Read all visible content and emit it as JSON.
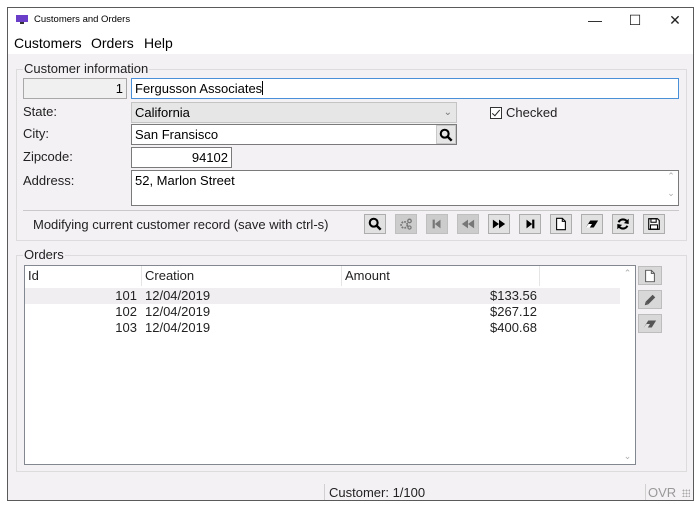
{
  "window": {
    "title": "Customers and Orders",
    "controls": {
      "minimize": "—",
      "maximize": "☐",
      "close": "✕"
    }
  },
  "menu": [
    "Customers",
    "Orders",
    "Help"
  ],
  "customer_info": {
    "group_label": "Customer information",
    "id_value": "1",
    "name_value": "Fergusson Associates",
    "state_label": "State:",
    "state_value": "California",
    "checkbox_label": "Checked",
    "checkbox_checked": true,
    "city_label": "City:",
    "city_value": "San Fransisco",
    "zip_label": "Zipcode:",
    "zip_value": "94102",
    "address_label": "Address:",
    "address_value": "52, Marlon Street"
  },
  "toolbar": {
    "status_message": "Modifying current customer record (save with ctrl-s)",
    "buttons": [
      {
        "name": "search",
        "icon": "search-icon",
        "enabled": true
      },
      {
        "name": "settings",
        "icon": "gears-icon",
        "enabled": false
      },
      {
        "name": "first",
        "icon": "first-record-icon",
        "enabled": false
      },
      {
        "name": "previous",
        "icon": "previous-record-icon",
        "enabled": false
      },
      {
        "name": "next",
        "icon": "next-record-icon",
        "enabled": true
      },
      {
        "name": "last",
        "icon": "last-record-icon",
        "enabled": true
      },
      {
        "name": "new",
        "icon": "new-document-icon",
        "enabled": true
      },
      {
        "name": "delete",
        "icon": "eraser-icon",
        "enabled": true
      },
      {
        "name": "refresh",
        "icon": "refresh-icon",
        "enabled": true
      },
      {
        "name": "save",
        "icon": "save-icon",
        "enabled": true
      }
    ]
  },
  "orders": {
    "group_label": "Orders",
    "columns": [
      "Id",
      "Creation",
      "Amount"
    ],
    "rows": [
      {
        "id": "101",
        "creation": "12/04/2019",
        "amount": "$133.56"
      },
      {
        "id": "102",
        "creation": "12/04/2019",
        "amount": "$267.12"
      },
      {
        "id": "103",
        "creation": "12/04/2019",
        "amount": "$400.68"
      }
    ],
    "side_buttons": [
      "new-order",
      "edit-order",
      "delete-order"
    ]
  },
  "statusbar": {
    "record_position": "Customer: 1/100",
    "mode": "OVR"
  }
}
